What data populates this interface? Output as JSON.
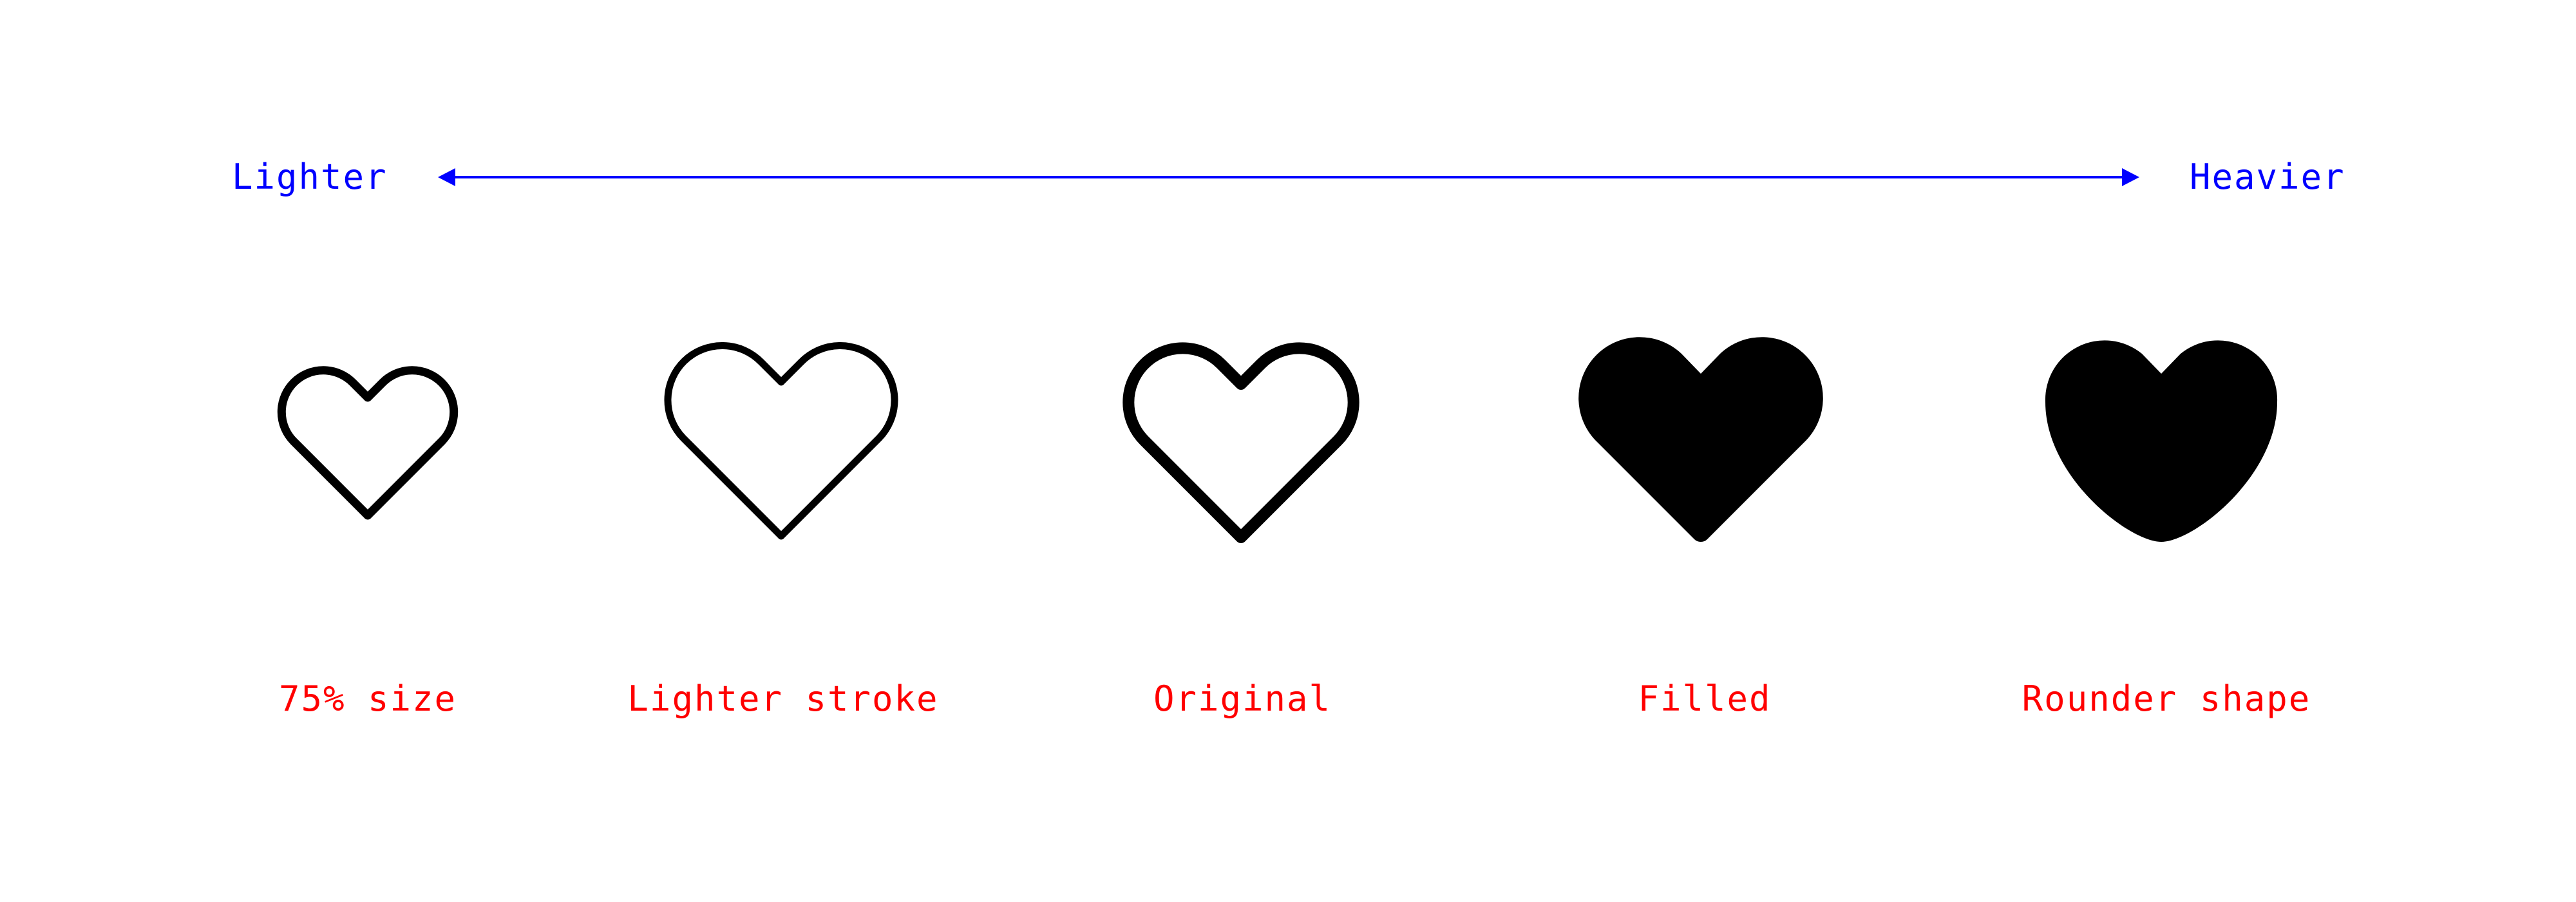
{
  "scale": {
    "left_label": "Lighter",
    "right_label": "Heavier",
    "arrow_color": "#0000ff"
  },
  "hearts": [
    {
      "id": "75-size",
      "label": "75% size",
      "style": "outline",
      "scale_percent": 75,
      "stroke": "regular"
    },
    {
      "id": "lighter-stroke",
      "label": "Lighter stroke",
      "style": "outline",
      "scale_percent": 100,
      "stroke": "light"
    },
    {
      "id": "original",
      "label": "Original",
      "style": "outline",
      "scale_percent": 100,
      "stroke": "regular"
    },
    {
      "id": "filled",
      "label": "Filled",
      "style": "filled",
      "scale_percent": 100,
      "stroke": "none"
    },
    {
      "id": "rounder-shape",
      "label": "Rounder shape",
      "style": "filled-round",
      "scale_percent": 100,
      "stroke": "none"
    }
  ],
  "colors": {
    "scale_text": "#0000ff",
    "caption_text": "#ff0000",
    "icon": "#000000",
    "background": "#ffffff"
  }
}
